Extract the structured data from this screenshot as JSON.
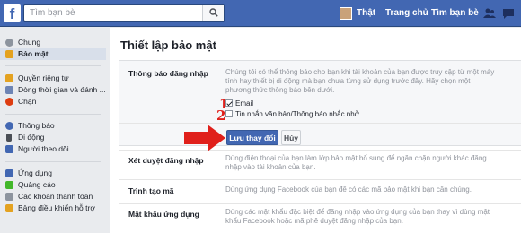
{
  "colors": {
    "brand": "#4267b2",
    "arrow": "#e0201b",
    "numbers": "#e0201b"
  },
  "topbar": {
    "logo": "f",
    "search_placeholder": "Tìm bạn bè",
    "user_name": "Thật",
    "home": "Trang chủ",
    "find_friends": "Tìm bạn bè",
    "icons": [
      "search-icon",
      "friends-icon",
      "messages-icon"
    ]
  },
  "sidebar": {
    "items": [
      {
        "label": "Chung",
        "icon": "gear-icon"
      },
      {
        "label": "Bảo mật",
        "icon": "shield-icon",
        "active": true
      },
      {
        "label": "Quyền riêng tư",
        "icon": "lock-icon"
      },
      {
        "label": "Dòng thời gian và đánh ...",
        "icon": "timeline-icon"
      },
      {
        "label": "Chặn",
        "icon": "block-icon"
      },
      {
        "label": "Thông báo",
        "icon": "globe-icon"
      },
      {
        "label": "Di động",
        "icon": "mobile-icon"
      },
      {
        "label": "Người theo dõi",
        "icon": "followers-icon"
      },
      {
        "label": "Ứng dụng",
        "icon": "apps-icon"
      },
      {
        "label": "Quảng cáo",
        "icon": "ads-icon"
      },
      {
        "label": "Các khoản thanh toán",
        "icon": "payments-icon"
      },
      {
        "label": "Bảng điều khiển hỗ trợ",
        "icon": "support-icon"
      }
    ]
  },
  "main": {
    "title": "Thiết lập bảo mật",
    "login_alerts": {
      "label": "Thông báo đăng nhập",
      "desc": "Chúng tôi có thể thông báo cho bạn khi tài khoản của bạn được truy cập từ một máy tính hay thiết bị di động mà bạn chưa từng sử dụng trước đây. Hãy chọn một phương thức thông báo bên dưới.",
      "options": [
        {
          "num": "1",
          "label": "Email",
          "checked": true
        },
        {
          "num": "2",
          "label": "Tin nhắn văn bản/Thông báo nhắc nhở",
          "checked": false
        }
      ],
      "save_label": "Lưu thay đổi",
      "cancel_label": "Hủy"
    },
    "rows": [
      {
        "label": "Xét duyệt đăng nhập",
        "desc": "Dùng điện thoại của bạn làm lớp bảo mật bổ sung để ngăn chặn người khác đăng nhập vào tài khoản của bạn."
      },
      {
        "label": "Trình tạo mã",
        "desc": "Dùng ứng dụng Facebook của bạn để có các mã bảo mật khi bạn cần chúng."
      },
      {
        "label": "Mật khẩu ứng dụng",
        "desc": "Dùng các mật khẩu đặc biệt để đăng nhập vào ứng dụng của bạn thay vì dùng mật khẩu Facebook hoặc mã phê duyệt đăng nhập của bạn."
      }
    ]
  }
}
